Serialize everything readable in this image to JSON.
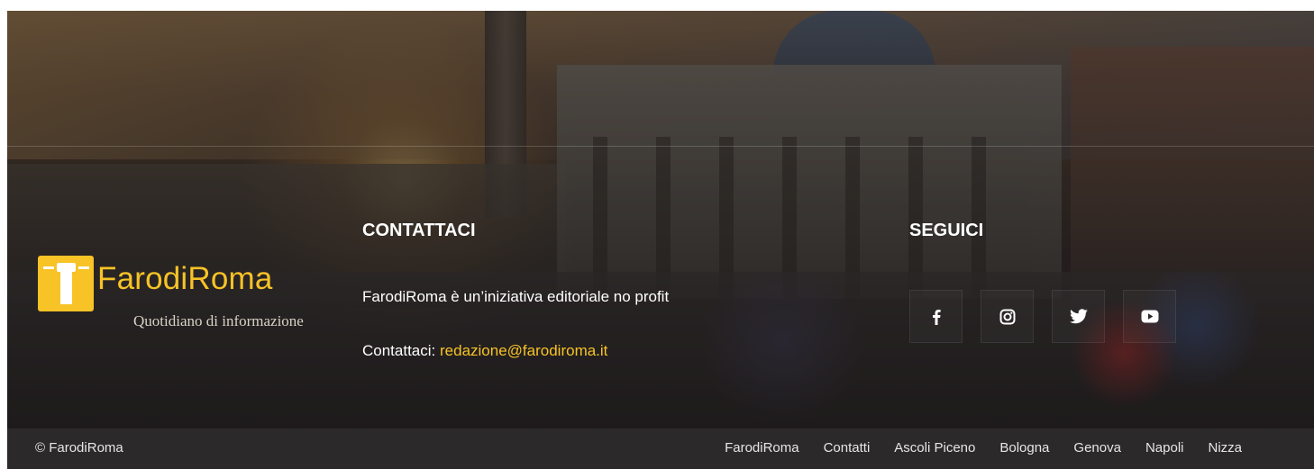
{
  "logo": {
    "brand": "FarodiRoma",
    "tagline": "Quotidiano di informazione",
    "icon": "lighthouse-icon",
    "color": "#f7c326"
  },
  "contact": {
    "heading": "CONTATTACI",
    "description": "FarodiRoma è un’iniziativa editoriale no profit",
    "label": "Contattaci:",
    "email": "redazione@farodiroma.it"
  },
  "follow": {
    "heading": "SEGUICI",
    "icons": [
      "facebook-icon",
      "instagram-icon",
      "twitter-icon",
      "youtube-icon"
    ]
  },
  "footer": {
    "copyright": "© FarodiRoma",
    "links": [
      "FarodiRoma",
      "Contatti",
      "Ascoli Piceno",
      "Bologna",
      "Genova",
      "Napoli",
      "Nizza"
    ]
  },
  "colors": {
    "accent": "#f7c326",
    "bottom_bar": "#2b2929"
  }
}
